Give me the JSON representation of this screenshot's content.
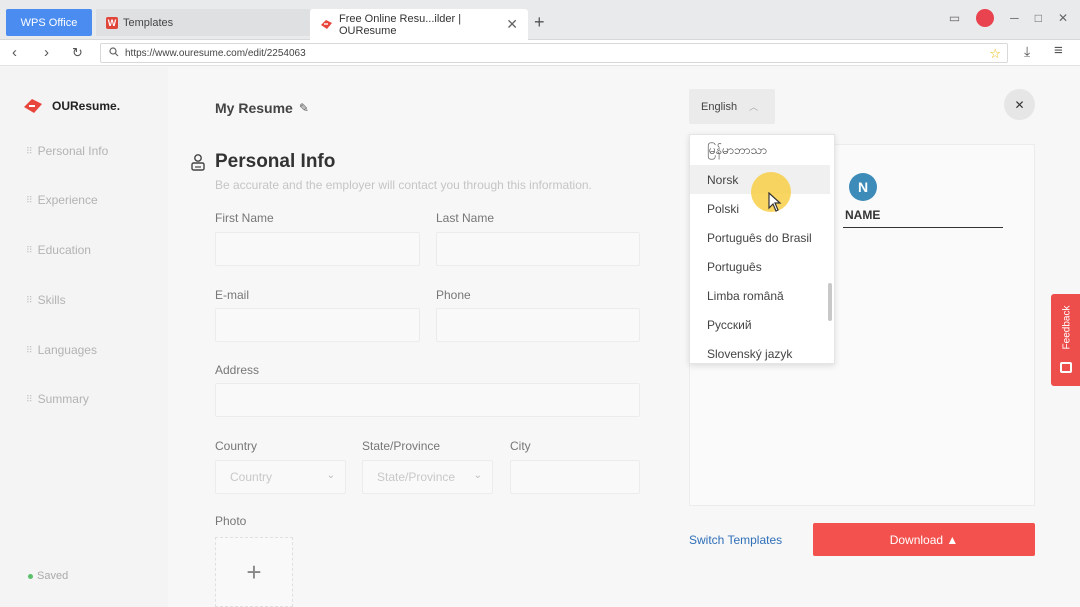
{
  "browser": {
    "tabs": [
      {
        "label": "WPS Office"
      },
      {
        "label": "Templates"
      },
      {
        "label": "Free Online Resu...ilder | OUResume"
      }
    ],
    "url": "https://www.ouresume.com/edit/2254063"
  },
  "sidebar": {
    "brand": "OUResume.",
    "items": [
      {
        "label": "Personal Info"
      },
      {
        "label": "Experience"
      },
      {
        "label": "Education"
      },
      {
        "label": "Skills"
      },
      {
        "label": "Languages"
      },
      {
        "label": "Summary"
      }
    ],
    "saved_label": "Saved"
  },
  "main": {
    "resume_title": "My Resume",
    "section_title": "Personal Info",
    "section_subtitle": "Be accurate and the employer will contact you through this information.",
    "fields": {
      "first_name": "First Name",
      "last_name": "Last Name",
      "email": "E-mail",
      "phone": "Phone",
      "address": "Address",
      "country": "Country",
      "country_placeholder": "Country",
      "state": "State/Province",
      "state_placeholder": "State/Province",
      "city": "City",
      "photo": "Photo"
    }
  },
  "language": {
    "selected": "English",
    "options": [
      "မြန်မာဘာသာ",
      "Norsk",
      "Polski",
      "Português do Brasil",
      "Português",
      "Limba română",
      "Русский",
      "Slovenský jazyk"
    ],
    "hovered_index": 1
  },
  "preview": {
    "avatar_letter": "N",
    "name": "NAME"
  },
  "actions": {
    "switch_templates": "Switch Templates",
    "download": "Download ▲",
    "feedback": "Feedback"
  },
  "colors": {
    "accent": "#f2514d",
    "link": "#2f6fb8",
    "avatar": "#3d8bb8",
    "wps_tab": "#4a8cf0"
  }
}
